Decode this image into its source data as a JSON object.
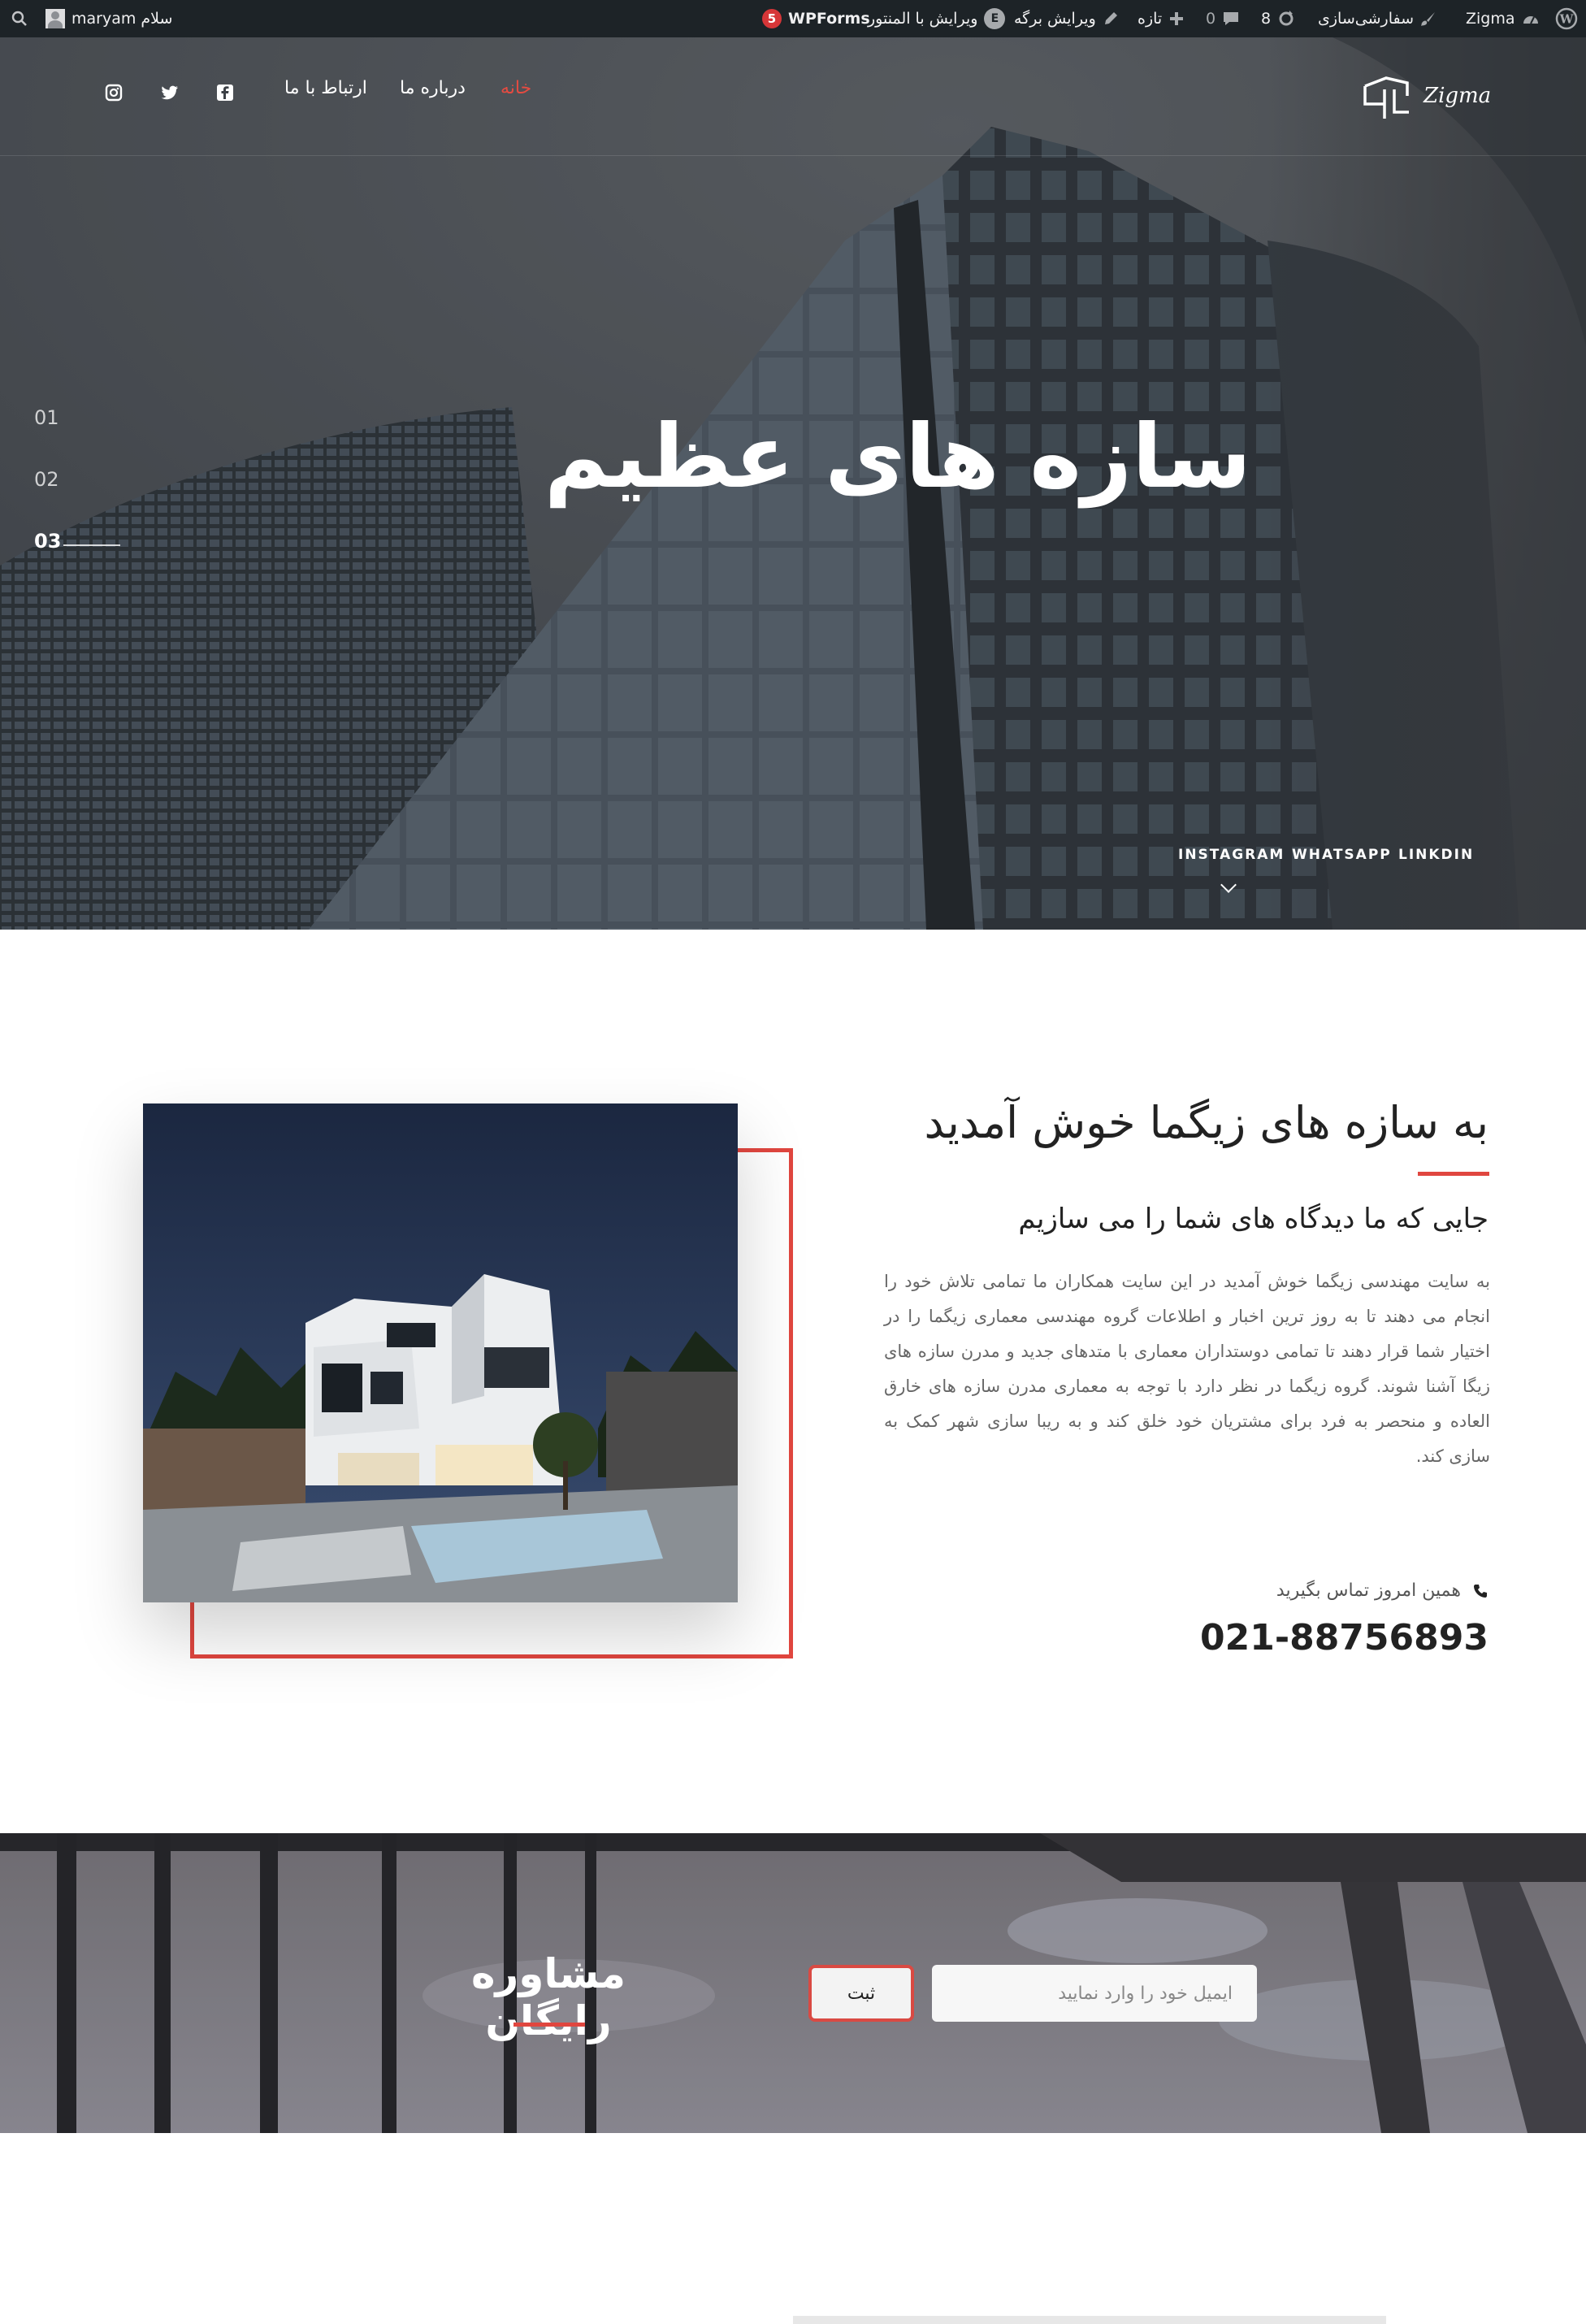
{
  "adminbar": {
    "greeting": "سلام maryam",
    "wpforms_label": "WPForms",
    "wpforms_count": "5",
    "edit_elementor": "ویرایش با المنتور",
    "edit_page": "ویرایش برگه",
    "new_label": "تازه",
    "comments_count": "0",
    "updates_count": "8",
    "customize": "سفارشی‌سازی",
    "site_name": "Zigma"
  },
  "nav": {
    "logo_text": "Zigma",
    "items": [
      {
        "label": "خانه",
        "active": true
      },
      {
        "label": "درباره ما",
        "active": false
      },
      {
        "label": "ارتباط با ما",
        "active": false
      }
    ],
    "social_icons": [
      "facebook-icon",
      "twitter-icon",
      "instagram-icon"
    ]
  },
  "hero": {
    "title": "سازه های عظیم",
    "slides": [
      "01",
      "02",
      "03"
    ],
    "active_slide": 3,
    "socials": [
      "INSTAGRAM",
      "WHATSAPP",
      "LINKDIN"
    ]
  },
  "welcome": {
    "title": "به سازه های زیگما خوش آمدید",
    "subtitle": "جایی که ما دیدگاه های شما را می سازیم",
    "body": "به سایت مهندسی زیگما خوش آمدید در این سایت همکاران ما تمامی تلاش خود را انجام می دهند تا به روز ترین اخبار و اطلاعات گروه مهندسی معماری زیگما را در اختیار شما قرار دهند تا تمامی دوستداران معماری با متدهای جدید و مدرن سازه های زیگا آشنا شوند. گروه زیگما در نظر دارد با توجه به معماری مدرن سازه های خارق العاده و منحصر به فرد برای مشتریان خود خلق کند و به ریبا سازی شهر کمک به سازی کند.",
    "call_label": "همین امروز تماس بگیرید",
    "phone": "021-88756893"
  },
  "consult": {
    "title": "مشاوره رایگان",
    "email_placeholder": "ایمیل خود را وارد نمایید",
    "submit_label": "ثبت"
  },
  "colors": {
    "accent": "#e0463f",
    "adminbar_bg": "#1d2327",
    "hero_overlay": "#3b3f45"
  }
}
